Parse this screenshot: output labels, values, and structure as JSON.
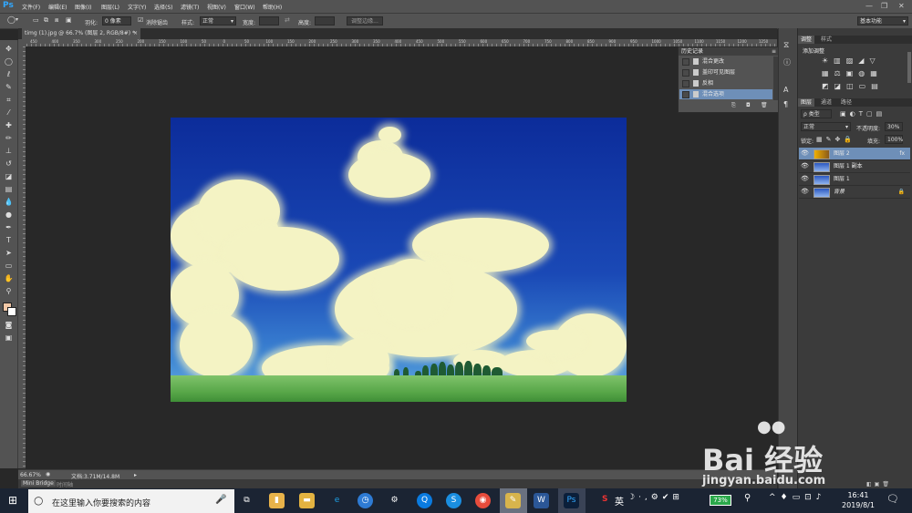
{
  "app": {
    "logo": "Ps"
  },
  "menubar": {
    "items": [
      "文件(F)",
      "编辑(E)",
      "图像(I)",
      "图层(L)",
      "文字(Y)",
      "选择(S)",
      "滤镜(T)",
      "视图(V)",
      "窗口(W)",
      "帮助(H)"
    ]
  },
  "options": {
    "feather_label": "羽化:",
    "feather_value": "0 像素",
    "antialias_label": "消除锯齿",
    "style_label": "样式:",
    "style_value": "正常",
    "width_label": "宽度:",
    "height_label": "高度:",
    "refine_edge": "调整边缘...",
    "workspace": "基本功能"
  },
  "document": {
    "tab_title": "timg (1).jpg @ 66.7% (图层 2, RGB/8#) *",
    "ruler_numbers": [
      "450",
      "400",
      "350",
      "300",
      "250",
      "200",
      "150",
      "100",
      "50",
      "0",
      "50",
      "100",
      "150",
      "200",
      "250",
      "300",
      "350",
      "400",
      "450",
      "500",
      "550",
      "600",
      "650",
      "700",
      "750",
      "800",
      "850",
      "900",
      "950",
      "1000",
      "1050",
      "1100",
      "1150",
      "1200",
      "1250"
    ]
  },
  "history_panel": {
    "title": "历史记录",
    "items": [
      {
        "label": "混合更改",
        "selected": false
      },
      {
        "label": "盖印可见图层",
        "selected": false
      },
      {
        "label": "反相",
        "selected": false
      },
      {
        "label": "混合选项",
        "selected": true
      }
    ]
  },
  "adjustments_panel": {
    "tabs": [
      "调整",
      "样式"
    ],
    "title": "添加调整"
  },
  "layers_panel": {
    "tabs": [
      "图层",
      "通道",
      "路径"
    ],
    "kind_label": "ρ 类型",
    "blend_mode": "正常",
    "opacity_label": "不透明度:",
    "opacity_value": "30%",
    "lock_label": "锁定:",
    "fill_label": "填充:",
    "fill_value": "100%",
    "layers": [
      {
        "name": "图层 2",
        "selected": true
      },
      {
        "name": "图层 1 副本",
        "selected": false
      },
      {
        "name": "图层 1",
        "selected": false
      },
      {
        "name": "背景",
        "selected": false
      }
    ]
  },
  "statusbar": {
    "zoom": "66.67%",
    "doc_size": "文档:3.71M/14.8M"
  },
  "minibridge": {
    "tabs": [
      "Mini Bridge",
      "时间轴"
    ]
  },
  "taskbar": {
    "search_placeholder": "在这里输入你要搜索的内容",
    "ime": "英",
    "battery": "73%",
    "time": "16:41",
    "date": "2019/8/1"
  },
  "watermark": {
    "brand": "Bai 经验",
    "url": "jingyan.baidu.com"
  },
  "colors": {
    "ui_dark": "#282828",
    "ui_panel": "#535353",
    "selection": "#6e8fb8",
    "ps_blue": "#31a8ff",
    "taskbar": "#1b2433"
  }
}
